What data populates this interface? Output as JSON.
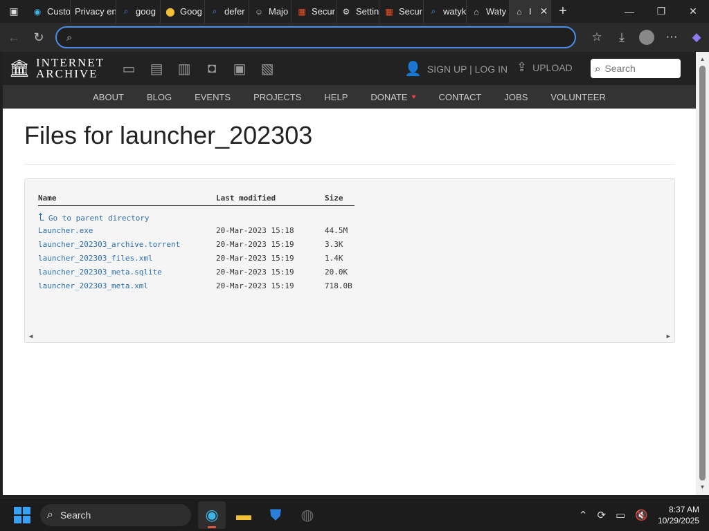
{
  "browser": {
    "tabs": [
      {
        "label": "Custo",
        "icon": "edge-icon"
      },
      {
        "label": "Privacy en",
        "icon": "page-icon"
      },
      {
        "label": "goog",
        "icon": "search-icon"
      },
      {
        "label": "Goog",
        "icon": "maps-icon"
      },
      {
        "label": "defer",
        "icon": "search-icon"
      },
      {
        "label": "Majo",
        "icon": "avatar-icon"
      },
      {
        "label": "Secur",
        "icon": "microsoft-icon"
      },
      {
        "label": "Settin",
        "icon": "gear-icon"
      },
      {
        "label": "Secur",
        "icon": "microsoft-icon"
      },
      {
        "label": "watyk",
        "icon": "search-icon"
      },
      {
        "label": "Waty",
        "icon": "archive-icon"
      },
      {
        "label": "I",
        "icon": "archive-icon",
        "active": true
      }
    ],
    "address": {
      "value": "",
      "placeholder": ""
    }
  },
  "ia": {
    "logo_line1": "INTERNET",
    "logo_line2": "ARCHIVE",
    "signup": "SIGN UP | LOG IN",
    "upload": "UPLOAD",
    "search_placeholder": "Search",
    "nav": [
      "ABOUT",
      "BLOG",
      "EVENTS",
      "PROJECTS",
      "HELP",
      "DONATE",
      "CONTACT",
      "JOBS",
      "VOLUNTEER"
    ]
  },
  "page": {
    "title": "Files for launcher_202303",
    "columns": {
      "name": "Name",
      "modified": "Last modified",
      "size": "Size"
    },
    "parent_link": "Go to parent directory",
    "files": [
      {
        "name": "Launcher.exe",
        "modified": "20-Mar-2023 15:18",
        "size": "44.5M"
      },
      {
        "name": "launcher_202303_archive.torrent",
        "modified": "20-Mar-2023 15:19",
        "size": "3.3K"
      },
      {
        "name": "launcher_202303_files.xml",
        "modified": "20-Mar-2023 15:19",
        "size": "1.4K"
      },
      {
        "name": "launcher_202303_meta.sqlite",
        "modified": "20-Mar-2023 15:19",
        "size": "20.0K"
      },
      {
        "name": "launcher_202303_meta.xml",
        "modified": "20-Mar-2023 15:19",
        "size": "718.0B"
      }
    ]
  },
  "taskbar": {
    "search_label": "Search",
    "time": "8:37 AM",
    "date": "10/29/2025"
  },
  "colors": {
    "accent": "#4a8fe8",
    "link": "#2a6fb0",
    "ia_dark": "#222222"
  }
}
